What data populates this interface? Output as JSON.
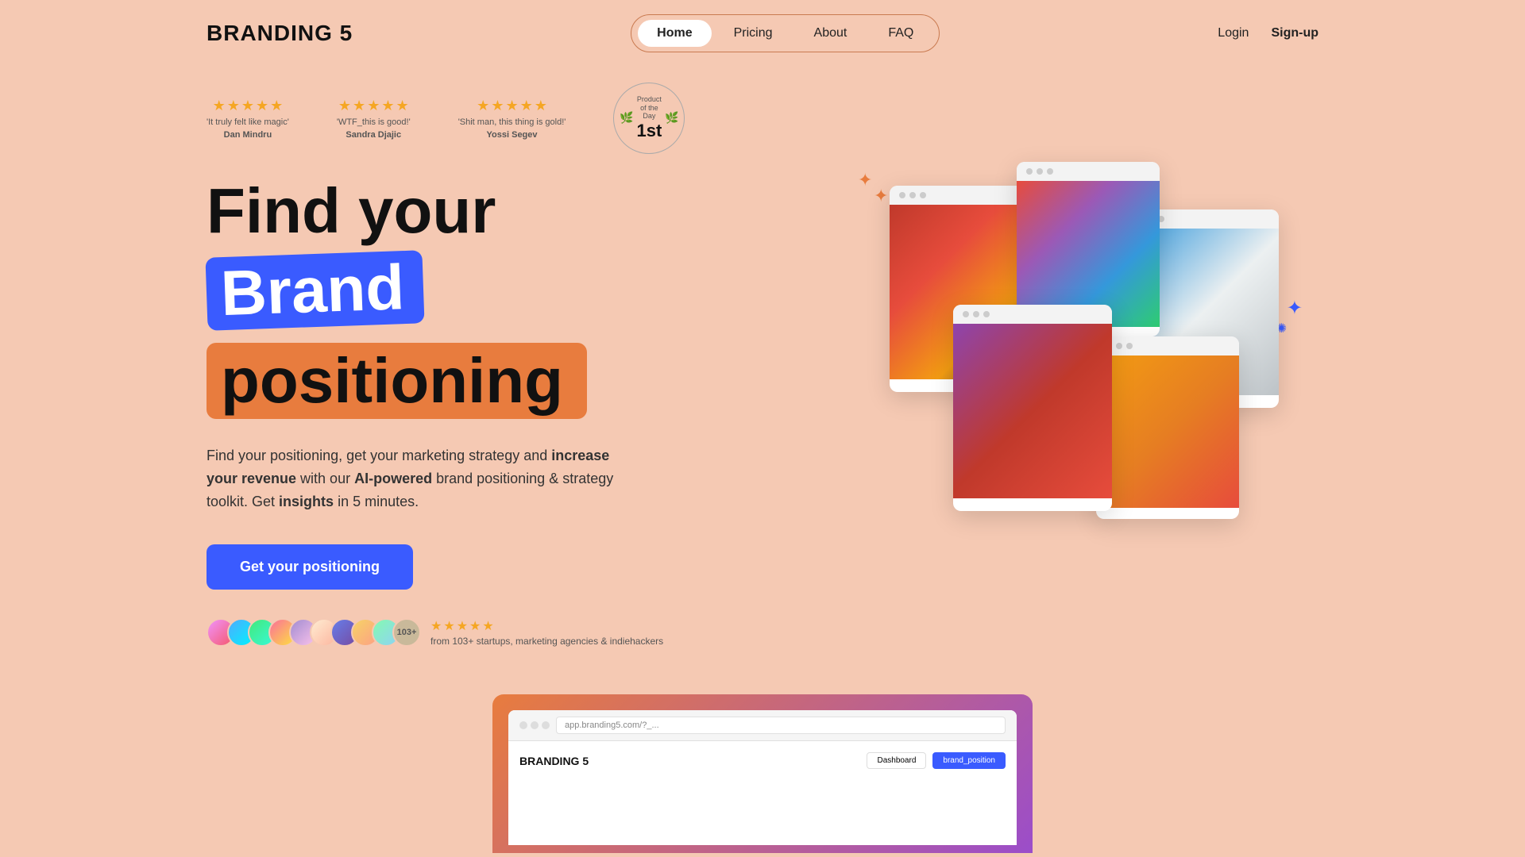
{
  "logo": "BRANDING 5",
  "nav": {
    "items": [
      {
        "label": "Home",
        "active": true
      },
      {
        "label": "Pricing",
        "active": false
      },
      {
        "label": "About",
        "active": false
      },
      {
        "label": "FAQ",
        "active": false
      }
    ]
  },
  "auth": {
    "login_label": "Login",
    "signup_label": "Sign-up"
  },
  "testimonials": [
    {
      "text": "'It truly felt like magic'",
      "author": "Dan Mindru",
      "stars": 5
    },
    {
      "text": "'WTF_this is good!'",
      "author": "Sandra Djajic",
      "stars": 5
    },
    {
      "text": "'Shit man, this thing is gold!'",
      "author": "Yossi Segev",
      "stars": 5
    }
  ],
  "badge": {
    "label": "Product of the Day",
    "rank": "1st"
  },
  "hero": {
    "line1": "Find your",
    "line2": "Brand",
    "line3": "positioning",
    "description_plain": "Find your positioning, get your marketing strategy and ",
    "description_bold1": "increase your revenue",
    "description_mid": " with our ",
    "description_bold2": "AI-powered",
    "description_end": " brand positioning & strategy toolkit. Get ",
    "description_bold3": "insights",
    "description_last": " in 5 minutes."
  },
  "cta": {
    "label": "Get your positioning"
  },
  "social": {
    "count_label": "103+",
    "review_text": "from 103+ startups, marketing agencies & indiehackers",
    "stars": 5
  },
  "screenshot": {
    "url_text": "app.branding5.com/?_...",
    "logo_text": "BRANDING 5",
    "btn1": "Dashboard",
    "btn2": "brand_position"
  },
  "decorations": {
    "spark1": "✦",
    "spark2": "✦",
    "spark3": "✺",
    "star_char": "★"
  }
}
